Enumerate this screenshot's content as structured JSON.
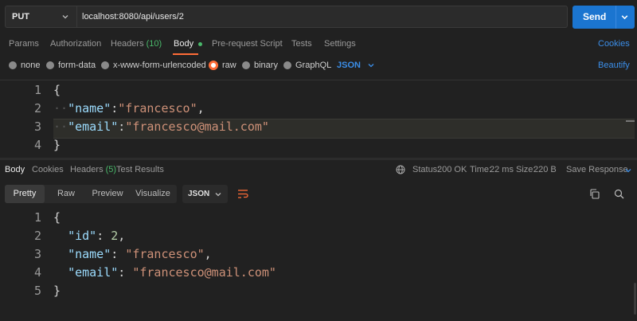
{
  "request": {
    "method": "PUT",
    "url": "localhost:8080/api/users/2",
    "send_label": "Send"
  },
  "request_tabs": {
    "params": "Params",
    "authorization": "Authorization",
    "headers": "Headers",
    "headers_count": "(10)",
    "body": "Body",
    "prerequest": "Pre-request Script",
    "tests": "Tests",
    "settings": "Settings",
    "cookies": "Cookies"
  },
  "body_types": {
    "none": "none",
    "form_data": "form-data",
    "urlencoded": "x-www-form-urlencoded",
    "raw": "raw",
    "binary": "binary",
    "graphql": "GraphQL",
    "format": "JSON",
    "beautify": "Beautify",
    "selected": "raw"
  },
  "request_body": {
    "line_numbers": [
      "1",
      "2",
      "3",
      "4"
    ],
    "open_brace": "{",
    "close_brace": "}",
    "name_key": "\"name\"",
    "name_value": "\"francesco\"",
    "email_key": "\"email\"",
    "email_value": "\"francesco@mail.com\""
  },
  "response_tabs": {
    "body": "Body",
    "cookies": "Cookies",
    "headers": "Headers",
    "headers_count": "(5)",
    "test_results": "Test Results"
  },
  "response_status": {
    "status_label": "Status:",
    "status_value": "200 OK",
    "time_label": "Time:",
    "time_value": "22 ms",
    "size_label": "Size:",
    "size_value": "220 B",
    "save_response": "Save Response"
  },
  "response_view": {
    "pretty": "Pretty",
    "raw": "Raw",
    "preview": "Preview",
    "visualize": "Visualize",
    "format": "JSON"
  },
  "response_body": {
    "line_numbers": [
      "1",
      "2",
      "3",
      "4",
      "5"
    ],
    "open_brace": "{",
    "close_brace": "}",
    "id_key": "\"id\"",
    "id_value": "2",
    "name_key": "\"name\"",
    "name_value": "\"francesco\"",
    "email_key": "\"email\"",
    "email_value": "\"francesco@mail.com\""
  },
  "colors": {
    "accent_orange": "#ff6c37",
    "primary_blue": "#1b75d0",
    "link_blue": "#3b8ee8",
    "status_green": "#49b86a"
  },
  "icons": [
    "chevron-down-icon",
    "globe-icon",
    "copy-icon",
    "search-icon",
    "wrap-lines-icon"
  ]
}
